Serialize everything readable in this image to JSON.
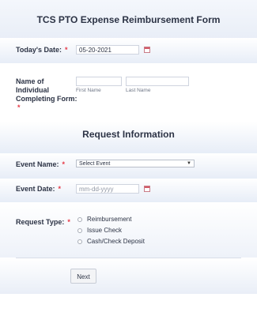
{
  "form_title": "TCS PTO Expense Reimbursement Form",
  "todays_date": {
    "label": "Today's Date:",
    "required_mark": "*",
    "value": "05-20-2021",
    "icon": "calendar-icon"
  },
  "name": {
    "label_line1": "Name of",
    "label_line2": "Individual",
    "label_line3": "Completing Form:",
    "required_mark": "*",
    "first_sublabel": "First Name",
    "last_sublabel": "Last Name"
  },
  "section_title": "Request Information",
  "event_name": {
    "label": "Event Name:",
    "required_mark": "*",
    "selected": "Select Event"
  },
  "event_date": {
    "label": "Event Date:",
    "required_mark": "*",
    "placeholder": "mm-dd-yyyy",
    "icon": "calendar-icon"
  },
  "request_type": {
    "label": "Request Type:",
    "required_mark": "*",
    "options": [
      "Reimbursement",
      "Issue Check",
      "Cash/Check Deposit"
    ]
  },
  "next_button": "Next"
}
